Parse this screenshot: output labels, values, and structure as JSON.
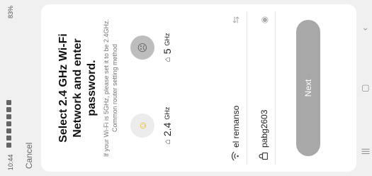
{
  "status": {
    "time": "10:44",
    "battery": "83%"
  },
  "cancel_label": "Cancel",
  "title": "Select 2.4 GHz Wi-Fi Network and enter password.",
  "hint_line1": "If your Wi-Fi is 5GHz, please set it to be 2.4GHz.",
  "hint_line2": "Common router setting method",
  "bands": {
    "b24_num": "2.4",
    "b24_unit": "GHz",
    "b5_num": "5",
    "b5_unit": "GHz"
  },
  "wifi": {
    "ssid": "el remanso",
    "password": "pabg2603"
  },
  "next_label": "Next",
  "icons": {
    "wifi": "wifi-icon",
    "lock": "lock-icon",
    "switch": "swap-icon",
    "eye": "eye-icon",
    "happy": "smile-icon",
    "sad": "sad-icon"
  }
}
